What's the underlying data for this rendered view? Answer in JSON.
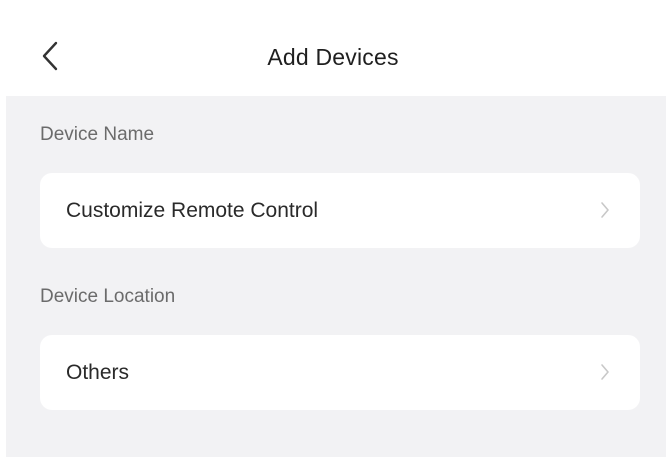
{
  "header": {
    "title": "Add Devices",
    "back_icon": "chevron-left-icon"
  },
  "sections": [
    {
      "label": "Device Name",
      "value": "Customize Remote Control",
      "icon": "chevron-right-icon"
    },
    {
      "label": "Device Location",
      "value": "Others",
      "icon": "chevron-right-icon"
    }
  ],
  "colors": {
    "background": "#f2f2f4",
    "card": "#ffffff",
    "label": "#6b6b6b",
    "chevron": "#c8c8c8"
  }
}
